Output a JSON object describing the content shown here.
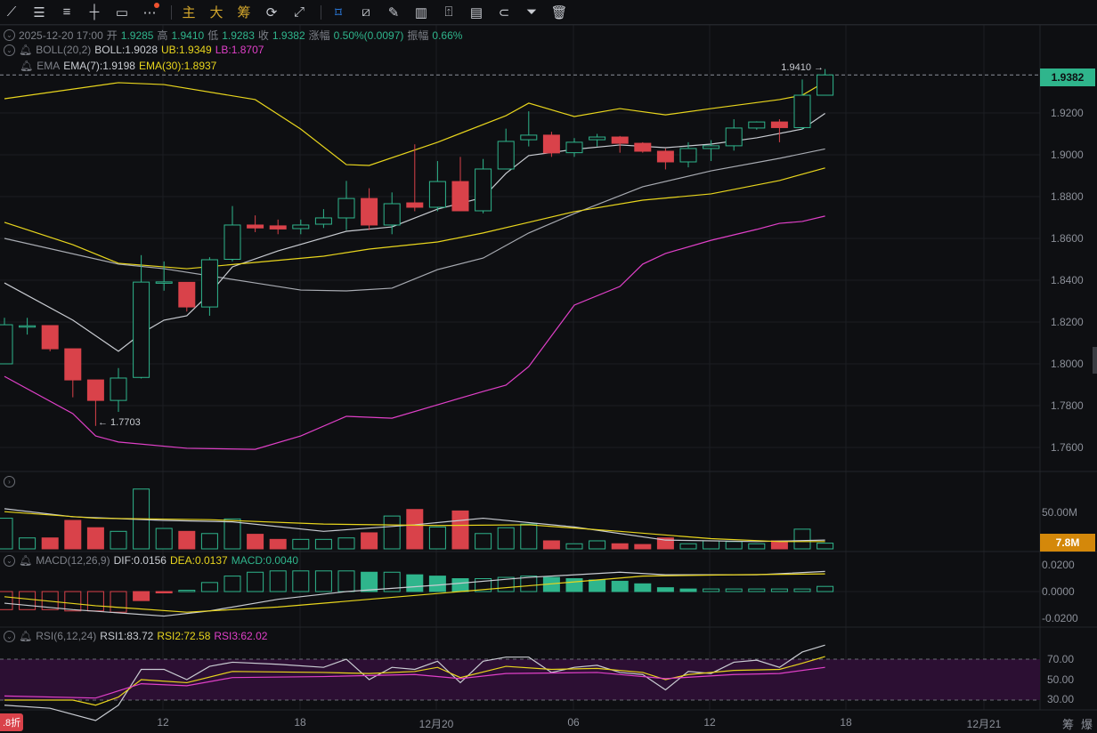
{
  "toolbar": {
    "tools": [
      "line-tool",
      "parallel-lines-tool",
      "fib-tool",
      "horizontal-line-tool",
      "rectangle-tool",
      "more-tools"
    ],
    "main_label": "主",
    "big_label": "大",
    "chip_label": "筹",
    "right_tools": [
      "snapshot",
      "eraser-draw",
      "bookmark",
      "ruler",
      "pen",
      "candle-type",
      "share",
      "notes",
      "magnet",
      "filter",
      "trash"
    ]
  },
  "ohlc": {
    "time": "2025-12-20 17:00",
    "open_label": "开",
    "open": "1.9285",
    "high_label": "高",
    "high": "1.9410",
    "low_label": "低",
    "low": "1.9283",
    "close_label": "收",
    "close": "1.9382",
    "change_label": "涨幅",
    "change": "0.50%(0.0097)",
    "amp_label": "振幅",
    "amp": "0.66%"
  },
  "boll": {
    "name": "BOLL(20,2)",
    "mid": "BOLL:1.9028",
    "ub": "UB:1.9349",
    "lb": "LB:1.8707"
  },
  "ema": {
    "name": "EMA",
    "ema7": "EMA(7):1.9198",
    "ema30": "EMA(30):1.8937"
  },
  "macd": {
    "name": "MACD(12,26,9)",
    "dif": "DIF:0.0156",
    "dea": "DEA:0.0137",
    "macd": "MACD:0.0040"
  },
  "rsi": {
    "name": "RSI(6,12,24)",
    "rsi1": "RSI1:83.72",
    "rsi2": "RSI2:72.58",
    "rsi3": "RSI3:62.02"
  },
  "price_axis": [
    "1.9200",
    "1.9000",
    "1.8800",
    "1.8600",
    "1.8400",
    "1.8200",
    "1.8000",
    "1.7800",
    "1.7600"
  ],
  "current_price": "1.9382",
  "high_marker": "1.9410 →",
  "low_marker": "← 1.7703",
  "volume_axis": "50.00M",
  "current_volume": "7.8M",
  "macd_axis": [
    "0.0200",
    "0.0000",
    "-0.0200"
  ],
  "rsi_axis": [
    "70.00",
    "50.00",
    "30.00"
  ],
  "x_axis": [
    "12",
    "18",
    "12月20",
    "06",
    "12",
    "18",
    "12月21"
  ],
  "discount_badge": ".8折",
  "bottom_right": [
    "筹",
    "爆"
  ],
  "colors": {
    "up": "#2fb58c",
    "down": "#d9424a",
    "ema7": "#c9ccd2",
    "ema30": "#e8d51d",
    "lb": "#e040c8",
    "current": "#d4880a"
  },
  "chart_data": {
    "type": "candlestick",
    "interval": "1h",
    "ylim": [
      1.75,
      1.95
    ],
    "candles": [
      [
        1.8,
        1.822,
        1.8,
        1.8187
      ],
      [
        1.818,
        1.822,
        1.814,
        1.8182
      ],
      [
        1.8183,
        1.8185,
        1.806,
        1.8072
      ],
      [
        1.8072,
        1.807,
        1.784,
        1.7923
      ],
      [
        1.7923,
        1.792,
        1.7703,
        1.7825
      ],
      [
        1.7825,
        1.798,
        1.777,
        1.7932
      ],
      [
        1.7935,
        1.852,
        1.793,
        1.8391
      ],
      [
        1.839,
        1.849,
        1.835,
        1.8392
      ],
      [
        1.839,
        1.839,
        1.825,
        1.8272
      ],
      [
        1.8272,
        1.851,
        1.823,
        1.8498
      ],
      [
        1.85,
        1.8755,
        1.849,
        1.8664
      ],
      [
        1.8664,
        1.871,
        1.863,
        1.865
      ],
      [
        1.866,
        1.869,
        1.862,
        1.8645
      ],
      [
        1.8647,
        1.869,
        1.862,
        1.8664
      ],
      [
        1.8668,
        1.874,
        1.865,
        1.8698
      ],
      [
        1.8698,
        1.8875,
        1.864,
        1.8791
      ],
      [
        1.8791,
        1.884,
        1.864,
        1.8664
      ],
      [
        1.8664,
        1.882,
        1.862,
        1.8766
      ],
      [
        1.877,
        1.905,
        1.873,
        1.8749
      ],
      [
        1.8749,
        1.897,
        1.873,
        1.8872
      ],
      [
        1.8872,
        1.899,
        1.873,
        1.8732
      ],
      [
        1.8732,
        1.898,
        1.872,
        1.8932
      ],
      [
        1.8932,
        1.9125,
        1.893,
        1.9064
      ],
      [
        1.9072,
        1.9208,
        1.904,
        1.9094
      ],
      [
        1.9094,
        1.911,
        1.899,
        1.9009
      ],
      [
        1.901,
        1.908,
        1.899,
        1.906
      ],
      [
        1.9072,
        1.91,
        1.904,
        1.9085
      ],
      [
        1.9085,
        1.909,
        1.901,
        1.9055
      ],
      [
        1.9055,
        1.906,
        1.901,
        1.9017
      ],
      [
        1.9017,
        1.903,
        1.893,
        1.8966
      ],
      [
        1.8966,
        1.906,
        1.894,
        1.903
      ],
      [
        1.903,
        1.907,
        1.897,
        1.9043
      ],
      [
        1.9043,
        1.917,
        1.902,
        1.9128
      ],
      [
        1.9128,
        1.916,
        1.912,
        1.9157
      ],
      [
        1.9157,
        1.917,
        1.906,
        1.913
      ],
      [
        1.913,
        1.936,
        1.912,
        1.9285
      ],
      [
        1.9285,
        1.941,
        1.9283,
        1.9382
      ]
    ],
    "lines": {
      "ub": [
        [
          0,
          1.9268
        ],
        [
          5,
          1.9345
        ],
        [
          7,
          1.9336
        ],
        [
          11,
          1.9264
        ],
        [
          13,
          1.9123
        ],
        [
          15,
          1.8953
        ],
        [
          16,
          1.8949
        ],
        [
          19,
          1.906
        ],
        [
          22,
          1.9187
        ],
        [
          23,
          1.9247
        ],
        [
          25,
          1.9183
        ],
        [
          27,
          1.9221
        ],
        [
          29,
          1.9191
        ],
        [
          31,
          1.9221
        ],
        [
          34,
          1.9264
        ],
        [
          35,
          1.9285
        ],
        [
          36,
          1.9349
        ]
      ],
      "mid": [
        [
          0,
          1.86
        ],
        [
          5,
          1.8477
        ],
        [
          7,
          1.8455
        ],
        [
          11,
          1.8387
        ],
        [
          13,
          1.8353
        ],
        [
          15,
          1.8349
        ],
        [
          17,
          1.8362
        ],
        [
          19,
          1.8451
        ],
        [
          21,
          1.8506
        ],
        [
          23,
          1.8626
        ],
        [
          25,
          1.8719
        ],
        [
          28,
          1.8847
        ],
        [
          31,
          1.8923
        ],
        [
          34,
          1.8983
        ],
        [
          36,
          1.9028
        ]
      ],
      "lb": [
        [
          0,
          1.794
        ],
        [
          3,
          1.7762
        ],
        [
          4,
          1.7655
        ],
        [
          5,
          1.7626
        ],
        [
          8,
          1.7596
        ],
        [
          11,
          1.7591
        ],
        [
          13,
          1.7655
        ],
        [
          15,
          1.7749
        ],
        [
          17,
          1.774
        ],
        [
          19,
          1.7804
        ],
        [
          21,
          1.7868
        ],
        [
          22,
          1.7898
        ],
        [
          23,
          1.7987
        ],
        [
          25,
          1.8281
        ],
        [
          27,
          1.837
        ],
        [
          28,
          1.8477
        ],
        [
          29,
          1.8528
        ],
        [
          31,
          1.8591
        ],
        [
          33,
          1.8643
        ],
        [
          34,
          1.8672
        ],
        [
          35,
          1.8681
        ],
        [
          36,
          1.8707
        ]
      ],
      "ema7": [
        [
          0,
          1.8387
        ],
        [
          3,
          1.8209
        ],
        [
          5,
          1.806
        ],
        [
          6,
          1.8145
        ],
        [
          7,
          1.8209
        ],
        [
          8,
          1.823
        ],
        [
          9,
          1.8336
        ],
        [
          10,
          1.8464
        ],
        [
          12,
          1.854
        ],
        [
          15,
          1.8634
        ],
        [
          17,
          1.8655
        ],
        [
          19,
          1.874
        ],
        [
          21,
          1.8796
        ],
        [
          22,
          1.8911
        ],
        [
          23,
          1.8996
        ],
        [
          25,
          1.9026
        ],
        [
          27,
          1.9047
        ],
        [
          29,
          1.9034
        ],
        [
          31,
          1.9051
        ],
        [
          33,
          1.9081
        ],
        [
          35,
          1.9123
        ],
        [
          36,
          1.9198
        ]
      ],
      "ema30": [
        [
          0,
          1.8677
        ],
        [
          3,
          1.857
        ],
        [
          5,
          1.8481
        ],
        [
          8,
          1.8455
        ],
        [
          11,
          1.8485
        ],
        [
          14,
          1.8515
        ],
        [
          16,
          1.8549
        ],
        [
          19,
          1.8583
        ],
        [
          21,
          1.8626
        ],
        [
          23,
          1.8677
        ],
        [
          25,
          1.8728
        ],
        [
          28,
          1.8783
        ],
        [
          31,
          1.8813
        ],
        [
          34,
          1.8877
        ],
        [
          36,
          1.8937
        ]
      ]
    },
    "volume_m": [
      42,
      15,
      15,
      39,
      29,
      24,
      82,
      28,
      24,
      21,
      41,
      20,
      13,
      13,
      13,
      15,
      22,
      45,
      54,
      30,
      52,
      21,
      29,
      34,
      11,
      7,
      11,
      7,
      6,
      15,
      7,
      11,
      10,
      7,
      11,
      27,
      7.8
    ],
    "volume_ma": {
      "ma5": [
        [
          0,
          55
        ],
        [
          3,
          44
        ],
        [
          7,
          39
        ],
        [
          10,
          37
        ],
        [
          14,
          24
        ],
        [
          18,
          33
        ],
        [
          21,
          42
        ],
        [
          25,
          30
        ],
        [
          29,
          12
        ],
        [
          33,
          10
        ],
        [
          36,
          12
        ]
      ],
      "ma10": [
        [
          0,
          51
        ],
        [
          4,
          42
        ],
        [
          9,
          40
        ],
        [
          14,
          34
        ],
        [
          19,
          32
        ],
        [
          23,
          33
        ],
        [
          27,
          24
        ],
        [
          31,
          14
        ],
        [
          34,
          10
        ],
        [
          36,
          10
        ]
      ]
    },
    "macd_hist": [
      -0.014,
      -0.014,
      -0.014,
      -0.015,
      -0.015,
      -0.016,
      -0.007,
      -0.001,
      0.001,
      0.007,
      0.012,
      0.015,
      0.016,
      0.016,
      0.016,
      0.016,
      0.015,
      0.015,
      0.013,
      0.012,
      0.01,
      0.01,
      0.011,
      0.012,
      0.011,
      0.01,
      0.009,
      0.008,
      0.006,
      0.003,
      0.002,
      0.002,
      0.002,
      0.002,
      0.002,
      0.002,
      0.004
    ],
    "dif": [
      [
        0,
        -0.009
      ],
      [
        3,
        -0.014
      ],
      [
        7,
        -0.019
      ],
      [
        9,
        -0.015
      ],
      [
        12,
        -0.006
      ],
      [
        15,
        0.0
      ],
      [
        19,
        0.005
      ],
      [
        23,
        0.011
      ],
      [
        27,
        0.015
      ],
      [
        29,
        0.013
      ],
      [
        33,
        0.013
      ],
      [
        36,
        0.0156
      ]
    ],
    "dea": [
      [
        0,
        -0.004
      ],
      [
        4,
        -0.011
      ],
      [
        8,
        -0.016
      ],
      [
        12,
        -0.012
      ],
      [
        16,
        -0.006
      ],
      [
        20,
        0.0
      ],
      [
        24,
        0.006
      ],
      [
        28,
        0.012
      ],
      [
        32,
        0.013
      ],
      [
        36,
        0.0137
      ]
    ],
    "rsi1": [
      [
        0,
        25
      ],
      [
        2,
        22
      ],
      [
        4,
        10
      ],
      [
        5,
        25
      ],
      [
        6,
        60
      ],
      [
        7,
        60
      ],
      [
        8,
        50
      ],
      [
        9,
        63
      ],
      [
        10,
        67
      ],
      [
        12,
        65
      ],
      [
        14,
        62
      ],
      [
        15,
        70
      ],
      [
        16,
        50
      ],
      [
        17,
        62
      ],
      [
        18,
        60
      ],
      [
        19,
        68
      ],
      [
        20,
        47
      ],
      [
        21,
        68
      ],
      [
        22,
        72
      ],
      [
        23,
        72
      ],
      [
        24,
        57
      ],
      [
        25,
        62
      ],
      [
        26,
        64
      ],
      [
        27,
        57
      ],
      [
        28,
        55
      ],
      [
        29,
        40
      ],
      [
        30,
        58
      ],
      [
        31,
        56
      ],
      [
        32,
        67
      ],
      [
        33,
        69
      ],
      [
        34,
        62
      ],
      [
        35,
        77
      ],
      [
        36,
        83.72
      ]
    ],
    "rsi2": [
      [
        0,
        30
      ],
      [
        3,
        30
      ],
      [
        4,
        25
      ],
      [
        5,
        33
      ],
      [
        6,
        50
      ],
      [
        8,
        47
      ],
      [
        10,
        58
      ],
      [
        14,
        57
      ],
      [
        16,
        56
      ],
      [
        18,
        58
      ],
      [
        19,
        62
      ],
      [
        20,
        52
      ],
      [
        22,
        63
      ],
      [
        24,
        60
      ],
      [
        26,
        61
      ],
      [
        28,
        57
      ],
      [
        29,
        50
      ],
      [
        30,
        55
      ],
      [
        32,
        59
      ],
      [
        34,
        60
      ],
      [
        35,
        66
      ],
      [
        36,
        72.58
      ]
    ],
    "rsi3": [
      [
        0,
        34
      ],
      [
        4,
        32
      ],
      [
        6,
        46
      ],
      [
        8,
        44
      ],
      [
        10,
        52
      ],
      [
        14,
        53
      ],
      [
        18,
        55
      ],
      [
        20,
        51
      ],
      [
        22,
        56
      ],
      [
        26,
        57
      ],
      [
        29,
        51
      ],
      [
        32,
        55
      ],
      [
        34,
        56
      ],
      [
        36,
        62.02
      ]
    ]
  }
}
